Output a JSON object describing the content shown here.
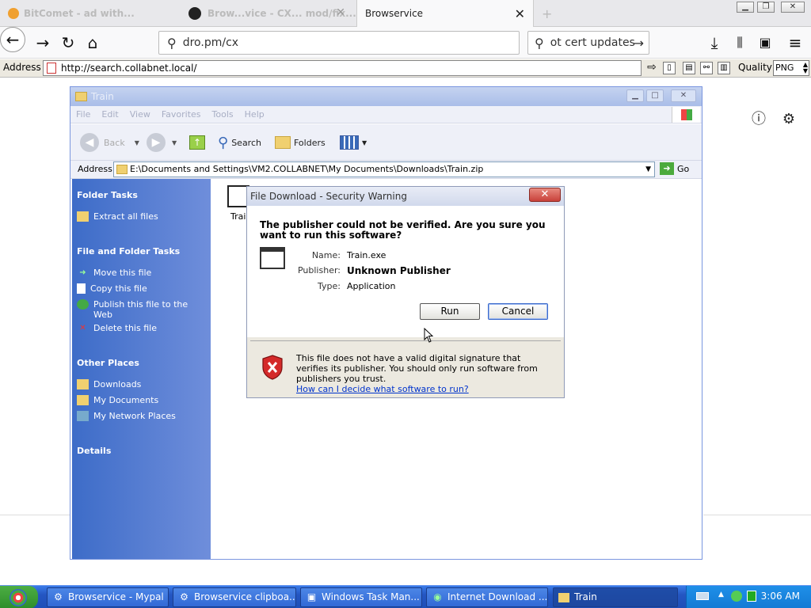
{
  "browser": {
    "tabs": [
      {
        "label": "BitComet - ad with..."
      },
      {
        "label": "Brow...vice - CX... mod/fix..."
      },
      {
        "label": "Browservice"
      }
    ],
    "url_text": "dro.pm/cx",
    "search_text": "ot cert updates"
  },
  "address_toolbar": {
    "label": "Address",
    "url": "http://search.collabnet.local/",
    "quality_label": "Quality",
    "quality_value": "PNG"
  },
  "explorer": {
    "title": "Train",
    "menu": [
      "File",
      "Edit",
      "View",
      "Favorites",
      "Tools",
      "Help"
    ],
    "toolbar": {
      "back": "Back",
      "search": "Search",
      "folders": "Folders"
    },
    "address_label": "Address",
    "address_path": "E:\\Documents and Settings\\VM2.COLLABNET\\My Documents\\Downloads\\Train.zip",
    "go_label": "Go",
    "sidebar": {
      "folder_tasks_title": "Folder Tasks",
      "folder_tasks": [
        {
          "label": "Extract all files"
        }
      ],
      "file_tasks_title": "File and Folder Tasks",
      "file_tasks": [
        {
          "label": "Move this file"
        },
        {
          "label": "Copy this file"
        },
        {
          "label": "Publish this file to the Web"
        },
        {
          "label": "Delete this file"
        }
      ],
      "other_places_title": "Other Places",
      "other_places": [
        {
          "label": "Downloads"
        },
        {
          "label": "My Documents"
        },
        {
          "label": "My Network Places"
        }
      ],
      "details_title": "Details"
    },
    "file_label": "Trai"
  },
  "dialog": {
    "title": "File Download - Security Warning",
    "question": "The publisher could not be verified.  Are you sure you want to run this software?",
    "name_key": "Name:",
    "name_value": "Train.exe",
    "publisher_key": "Publisher:",
    "publisher_value": "Unknown Publisher",
    "type_key": "Type:",
    "type_value": "Application",
    "run_label": "Run",
    "cancel_label": "Cancel",
    "warning": "This file does not have a valid digital signature that verifies its publisher.  You should only run software from publishers you trust.",
    "link": "How can I decide what software to run?"
  },
  "taskbar": {
    "tasks": [
      {
        "label": "Browservice - Mypal"
      },
      {
        "label": "Browservice clipboa..."
      },
      {
        "label": "Windows Task Man..."
      },
      {
        "label": "Internet Download ..."
      },
      {
        "label": "Train"
      }
    ],
    "clock": "3:06 AM"
  },
  "icons": [
    "back-arrow-icon",
    "forward-arrow-icon",
    "reload-icon",
    "home-icon",
    "search-icon",
    "download-icon",
    "library-icon",
    "sidebar-icon",
    "menu-icon",
    "info-icon",
    "gear-icon",
    "shield-warning-icon",
    "folder-icon",
    "windows-flag-icon"
  ]
}
